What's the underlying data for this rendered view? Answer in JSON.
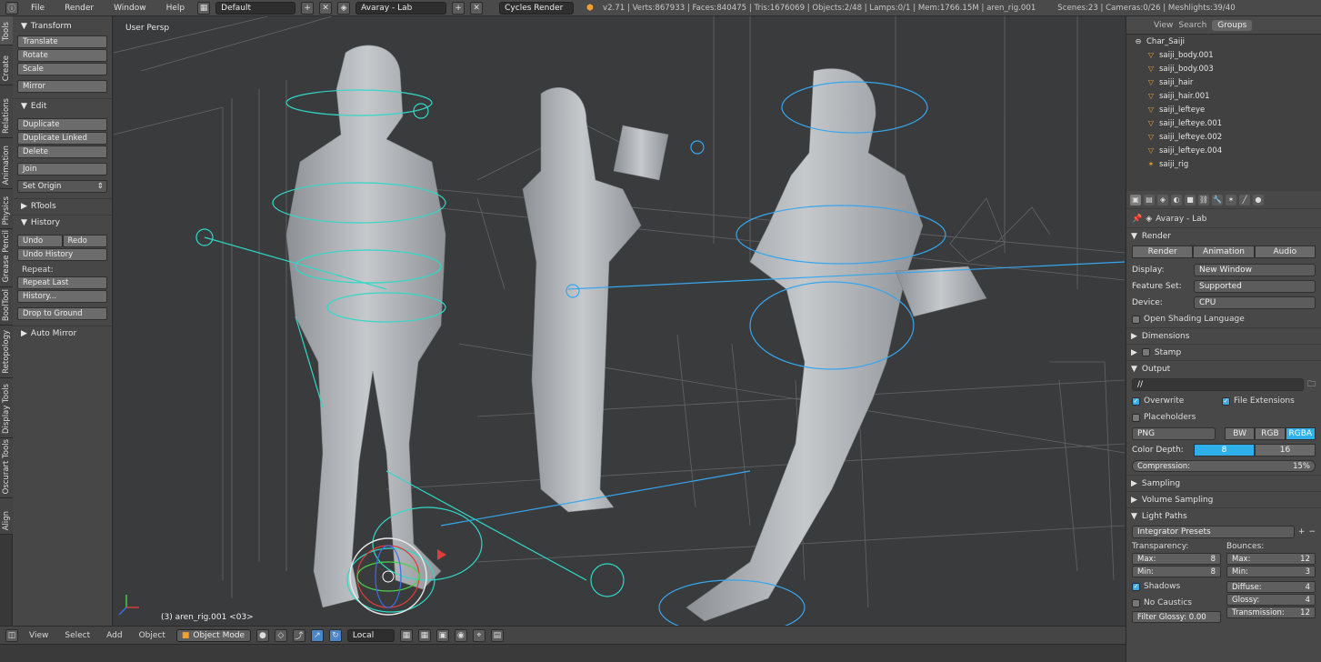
{
  "topbar": {
    "menus": [
      "File",
      "Render",
      "Window",
      "Help"
    ],
    "layout": "Default",
    "scene": "Avaray - Lab",
    "engine": "Cycles Render",
    "stats": "v2.71 | Verts:867933 | Faces:840475 | Tris:1676069 | Objects:2/48 | Lamps:0/1 | Mem:1766.15M | aren_rig.001",
    "stats_right": "Scenes:23 | Cameras:0/26 | Meshlights:39/40"
  },
  "tool_tabs": [
    "Tools",
    "Create",
    "Relations",
    "Animation",
    "Physics",
    "Grease Pencil",
    "BoolTool",
    "Retopology",
    "Display Tools",
    "Oscurart Tools",
    "Align"
  ],
  "toolshelf": {
    "transform": {
      "title": "Transform",
      "buttons": [
        "Translate",
        "Rotate",
        "Scale",
        "Mirror"
      ]
    },
    "edit": {
      "title": "Edit",
      "buttons": [
        "Duplicate",
        "Duplicate Linked",
        "Delete",
        "Join"
      ],
      "set_origin": "Set Origin"
    },
    "rtools": "RTools",
    "history": {
      "title": "History",
      "undo": "Undo",
      "redo": "Redo",
      "undo_history": "Undo History",
      "repeat_label": "Repeat:",
      "repeat_last": "Repeat Last",
      "history_btn": "History...",
      "drop": "Drop to Ground"
    },
    "auto_mirror": "Auto Mirror"
  },
  "viewport": {
    "label": "User Persp",
    "object": "(3) aren_rig.001 <03>"
  },
  "bottombar": {
    "menus": [
      "View",
      "Select",
      "Add",
      "Object"
    ],
    "mode": "Object Mode",
    "pivot": "Local"
  },
  "outliner": {
    "tabs": [
      "View",
      "Search",
      "Groups"
    ],
    "active_tab": "Groups",
    "group": "Char_Saiji",
    "items": [
      "saiji_body.001",
      "saiji_body.003",
      "saiji_hair",
      "saiji_hair.001",
      "saiji_lefteye",
      "saiji_lefteye.001",
      "saiji_lefteye.002",
      "saiji_lefteye.004",
      "saiji_rig"
    ]
  },
  "properties": {
    "scene_name": "Avaray - Lab",
    "render": {
      "title": "Render",
      "buttons": [
        "Render",
        "Animation",
        "Audio"
      ],
      "display_label": "Display:",
      "display": "New Window",
      "feature_label": "Feature Set:",
      "feature": "Supported",
      "device_label": "Device:",
      "device": "CPU",
      "osl": "Open Shading Language"
    },
    "dimensions": "Dimensions",
    "stamp": "Stamp",
    "output": {
      "title": "Output",
      "path": "//",
      "overwrite": "Overwrite",
      "file_ext": "File Extensions",
      "placeholders": "Placeholders",
      "format": "PNG",
      "channels": [
        "BW",
        "RGB",
        "RGBA"
      ],
      "active_channel": "RGBA",
      "depth_label": "Color Depth:",
      "depths": [
        "8",
        "16"
      ],
      "compression_label": "Compression:",
      "compression": "15%"
    },
    "sampling": "Sampling",
    "volume_sampling": "Volume Sampling",
    "light_paths": {
      "title": "Light Paths",
      "presets": "Integrator Presets",
      "transparency": "Transparency:",
      "t_max_l": "Max:",
      "t_max": "8",
      "t_min_l": "Min:",
      "t_min": "8",
      "bounces": "Bounces:",
      "b_max_l": "Max:",
      "b_max": "12",
      "b_min_l": "Min:",
      "b_min": "3",
      "shadows": "Shadows",
      "no_caustics": "No Caustics",
      "diffuse_l": "Diffuse:",
      "diffuse": "4",
      "glossy_l": "Glossy:",
      "glossy": "4",
      "transmission_l": "Transmission:",
      "transmission": "12",
      "filter_glossy": "Filter Glossy: 0.00"
    }
  }
}
